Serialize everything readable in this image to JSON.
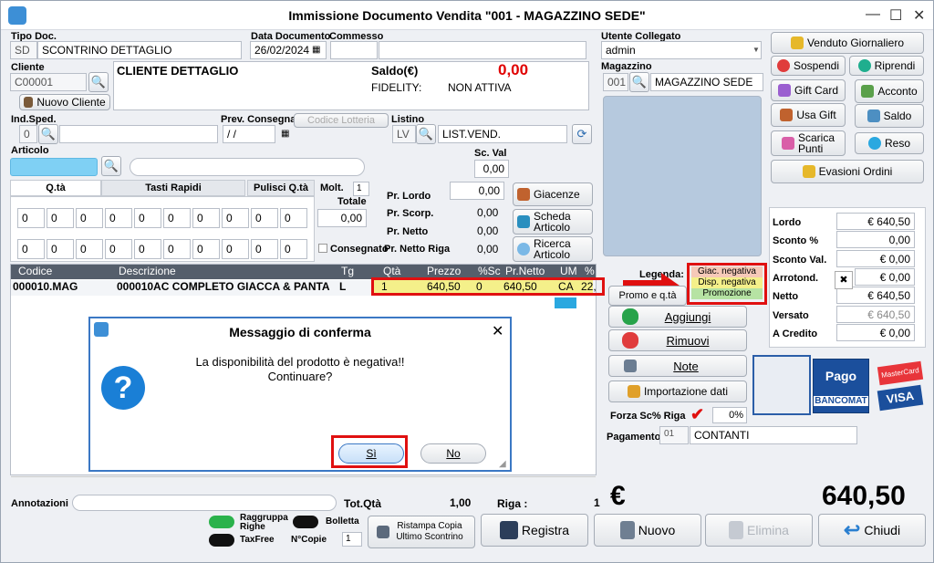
{
  "window": {
    "title": "Immissione Documento Vendita \"001 - MAGAZZINO SEDE\"",
    "minimize": "—",
    "maximize": "☐",
    "close": "✕"
  },
  "header": {
    "tipo_doc_label": "Tipo Doc.",
    "tipo_doc_code": "SD",
    "tipo_doc_value": "SCONTRINO DETTAGLIO",
    "data_label": "Data Documento",
    "data_value": "26/02/2024",
    "commesso_label": "Commesso",
    "utente_label": "Utente Collegato",
    "utente_value": "admin",
    "cliente_label": "Cliente",
    "cliente_code": "C00001",
    "cliente_name": "CLIENTE DETTAGLIO",
    "saldo_label": "Saldo(€)",
    "saldo_value": "0,00",
    "fidelity_label": "FIDELITY:",
    "fidelity_value": "NON ATTIVA",
    "nuovo_cliente": "Nuovo Cliente",
    "magazzino_label": "Magazzino",
    "magazzino_code": "001",
    "magazzino_value": "MAGAZZINO SEDE",
    "indsped_label": "Ind.Sped.",
    "indsped_value": "0",
    "prev_label": "Prev. Consegna",
    "prev_value": "/ /",
    "codice_lotteria": "Codice Lotteria",
    "listino_label": "Listino",
    "listino_code": "LV",
    "listino_value": "LIST.VEND.",
    "articolo_label": "Articolo",
    "scval_label": "Sc. Val",
    "scval_value": "0,00"
  },
  "tabs": {
    "qta": "Q.tà",
    "tasti": "Tasti Rapidi",
    "pulisci": "Pulisci Q.tà"
  },
  "qty_boxes": [
    "0",
    "0",
    "0",
    "0",
    "0",
    "0",
    "0",
    "0",
    "0",
    "0",
    "0",
    "0",
    "0",
    "0",
    "0",
    "0",
    "0",
    "0",
    "0",
    "0"
  ],
  "molt": {
    "label": "Molt.",
    "value": "1",
    "totale_label": "Totale",
    "totale_value": "0,00",
    "consegnato": "Consegnato"
  },
  "prices": {
    "lordo_label": "Pr. Lordo",
    "lordo": "0,00",
    "scorp_label": "Pr. Scorp.",
    "scorp": "0,00",
    "netto_label": "Pr. Netto",
    "netto": "0,00",
    "riga_label": "Pr. Netto Riga",
    "riga": "0,00"
  },
  "side_buttons": {
    "giacenze": "Giacenze",
    "scheda": "Scheda Articolo",
    "ricerca": "Ricerca Articolo",
    "promo": "Promo e q.tà"
  },
  "grid": {
    "headers": [
      "Codice",
      "Descrizione",
      "Tg",
      "Qtà",
      "Prezzo",
      "%Sc",
      "Pr.Netto",
      "UM",
      "%"
    ],
    "row": [
      "000010.MAG",
      "000010AC COMPLETO GIACCA & PANTA",
      "L",
      "1",
      "640,50",
      "0",
      "640,50",
      "CA",
      "22,"
    ]
  },
  "legend": {
    "label": "Legenda:",
    "items": [
      "Giac. negativa",
      "Disp. negativa",
      "Promozione"
    ],
    "colors": [
      "#f6c9b8",
      "#f4f08a",
      "#b6e3a3"
    ]
  },
  "actions": {
    "aggiungi": "Aggiungi",
    "rimuovi": "Rimuovi",
    "note": "Note",
    "importazione": "Importazione dati",
    "forza_label": "Forza Sc% Riga",
    "forza_value": "0%"
  },
  "pagamento": {
    "label": "Pagamento",
    "code": "01",
    "value": "CONTANTI"
  },
  "right_buttons": {
    "venduto": "Venduto Giornaliero",
    "sospendi": "Sospendi",
    "riprendi": "Riprendi",
    "giftcard": "Gift Card",
    "acconto": "Acconto",
    "usagift": "Usa Gift",
    "saldo": "Saldo",
    "scarica": "Scarica Punti",
    "reso": "Reso",
    "evasioni": "Evasioni Ordini"
  },
  "totals": [
    {
      "label": "Lordo",
      "value": "€ 640,50"
    },
    {
      "label": "Sconto %",
      "value": "0,00"
    },
    {
      "label": "Sconto Val.",
      "value": "€ 0,00"
    },
    {
      "label": "Arrotond.",
      "value": "€ 0,00"
    },
    {
      "label": "Netto",
      "value": "€ 640,50"
    },
    {
      "label": "Versato",
      "value": "€ 640,50"
    },
    {
      "label": "A Credito",
      "value": "€ 0,00"
    }
  ],
  "payment_logos": {
    "pagobancomat_1": "Pago",
    "pagobancomat_2": "BANCOMAT",
    "visa": "VISA",
    "mastercard": "MasterCard"
  },
  "footer": {
    "annotazioni": "Annotazioni",
    "totqta_label": "Tot.Qtà",
    "totqta": "1,00",
    "riga_label": "Riga :",
    "riga": "1",
    "euro": "€",
    "total": "640,50",
    "raggruppa": "Raggruppa Righe",
    "bolletta": "Bolletta",
    "taxfree": "TaxFree",
    "ncopie_label": "N°Copie",
    "ncopie": "1",
    "ristampa": "Ristampa Copia Ultimo Scontrino",
    "registra": "Registra",
    "nuovo": "Nuovo",
    "elimina": "Elimina",
    "chiudi": "Chiudi"
  },
  "dialog": {
    "title": "Messaggio di conferma",
    "message_1": "La disponibilità del prodotto è negativa!!",
    "message_2": "Continuare?",
    "si": "Sì",
    "no": "No",
    "close": "✕"
  }
}
